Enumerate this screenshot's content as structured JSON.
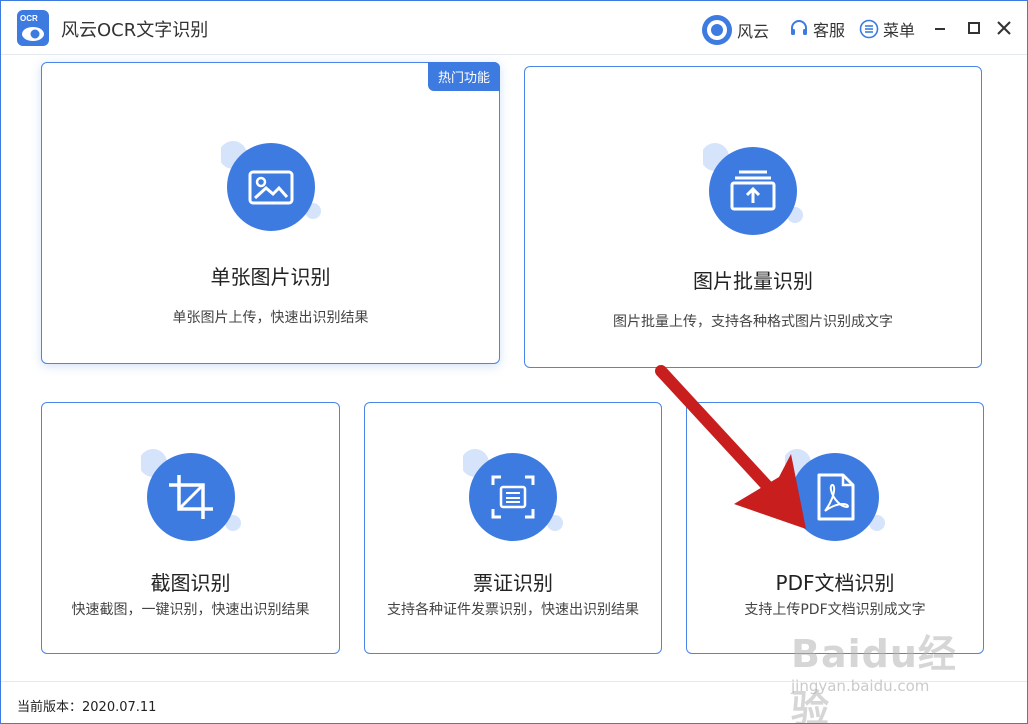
{
  "app": {
    "title": "风云OCR文字识别",
    "logo_text": "OCR"
  },
  "header": {
    "user_label": "风云",
    "service_label": "客服",
    "menu_label": "菜单"
  },
  "cards": {
    "single": {
      "title": "单张图片识别",
      "desc": "单张图片上传，快速出识别结果",
      "badge": "热门功能"
    },
    "batch": {
      "title": "图片批量识别",
      "desc": "图片批量上传，支持各种格式图片识别成文字"
    },
    "screenshot": {
      "title": "截图识别",
      "desc": "快速截图，一键识别，快速出识别结果"
    },
    "ticket": {
      "title": "票证识别",
      "desc": "支持各种证件发票识别，快速出识别结果"
    },
    "pdf": {
      "title": "PDF文档识别",
      "desc": "支持上传PDF文档识别成文字"
    }
  },
  "status": {
    "version_label": "当前版本：2020.07.11"
  },
  "watermark": {
    "brand": "Baidu经验",
    "url": "jingyan.baidu.com"
  },
  "colors": {
    "accent": "#3d7be0",
    "arrow": "#c81e1e"
  }
}
